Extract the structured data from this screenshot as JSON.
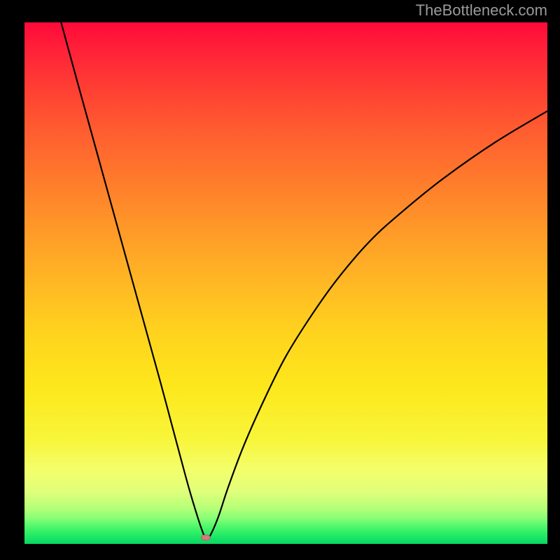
{
  "watermark": "TheBottleneck.com",
  "chart_data": {
    "type": "line",
    "title": "",
    "xlabel": "",
    "ylabel": "",
    "xlim": [
      0,
      100
    ],
    "ylim": [
      0,
      100
    ],
    "grid": false,
    "legend": false,
    "background_gradient": {
      "top_color": "#ff0a3a",
      "mid_color": "#ffd41e",
      "bottom_color": "#0bd563"
    },
    "series": [
      {
        "name": "bottleneck-curve",
        "color": "#000000",
        "x": [
          7,
          10,
          14,
          18,
          22,
          26,
          28,
          30,
          31.5,
          33,
          34,
          34.7,
          35.4,
          37,
          39,
          42,
          46,
          50,
          55,
          60,
          66,
          72,
          80,
          90,
          100
        ],
        "values": [
          100,
          89,
          74.5,
          60,
          45.5,
          31,
          23.5,
          16,
          10.5,
          5.5,
          2.5,
          1,
          1.4,
          5,
          11,
          19,
          28,
          36,
          44,
          51,
          58,
          63.5,
          70,
          77,
          83
        ]
      }
    ],
    "marker": {
      "x": 34.7,
      "y": 1.2,
      "color": "#d67b7b"
    }
  }
}
